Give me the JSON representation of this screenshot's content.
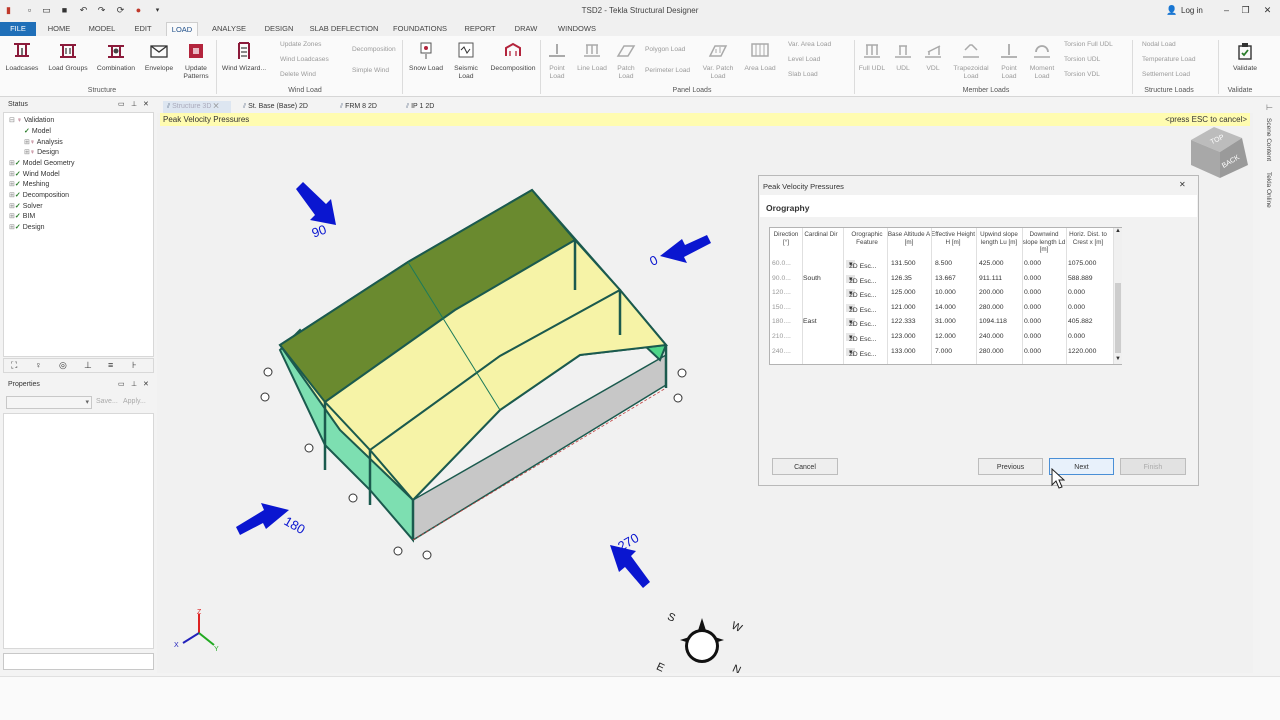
{
  "window": {
    "title": "TSD2 - Tekla Structural Designer",
    "login_label": "Log in"
  },
  "menu": {
    "tabs": [
      "FILE",
      "HOME",
      "MODEL",
      "EDIT",
      "LOAD",
      "ANALYSE",
      "DESIGN",
      "SLAB DEFLECTION",
      "FOUNDATIONS",
      "REPORT",
      "DRAW",
      "WINDOWS"
    ],
    "active": "LOAD"
  },
  "ribbon": {
    "structure": {
      "label": "Structure",
      "loadcases": "Loadcases",
      "load_groups": "Load Groups",
      "combination": "Combination",
      "envelope": "Envelope",
      "update_patterns": "Update Patterns"
    },
    "wind": {
      "label": "Wind Load",
      "wind_wizard": "Wind Wizard...",
      "update_zones": "Update Zones",
      "wind_loadcases": "Wind Loadcases",
      "delete_wind": "Delete Wind",
      "decomposition": "Decomposition",
      "simple_wind": "Simple Wind"
    },
    "snow_load": "Snow Load",
    "seismic_load": "Seismic Load",
    "decomposition": "Decomposition",
    "panel": {
      "label": "Panel Loads",
      "point_load": "Point Load",
      "line_load": "Line Load",
      "patch_load": "Patch Load",
      "polygon_load": "Polygon Load",
      "perimeter_load": "Perimeter Load",
      "var_patch_load": "Var. Patch Load",
      "area_load": "Area Load",
      "var_area_load": "Var. Area Load",
      "level_load": "Level Load",
      "slab_load": "Slab Load"
    },
    "member": {
      "label": "Member Loads",
      "full_udl": "Full UDL",
      "udl": "UDL",
      "vdl": "VDL",
      "trapezoidal_load": "Trapezoidal Load",
      "point_load": "Point Load",
      "moment_load": "Moment Load",
      "torsion_full_udl": "Torsion Full UDL",
      "torsion_udl": "Torsion UDL",
      "torsion_vdl": "Torsion VDL"
    },
    "structure_loads": {
      "label": "Structure Loads",
      "nodal_load": "Nodal Load",
      "temperature_load": "Temperature Load",
      "settlement_load": "Settlement Load"
    },
    "validate": {
      "label": "Validate",
      "button": "Validate"
    }
  },
  "status_panel": {
    "title": "Status",
    "items": [
      "Validation",
      "Model",
      "Analysis",
      "Design",
      "Model Geometry",
      "Wind Model",
      "Meshing",
      "Decomposition",
      "Solver",
      "BIM",
      "Design"
    ]
  },
  "properties_panel": {
    "title": "Properties",
    "save": "Save...",
    "apply": "Apply..."
  },
  "doc_tabs": [
    "Structure 3D",
    "St. Base (Base) 2D",
    "FRM 8 2D",
    "IP 1 2D"
  ],
  "side_tabs": [
    "Scene Content",
    "Tekla Online"
  ],
  "viewport": {
    "prompt_left": "Peak Velocity Pressures",
    "prompt_right": "<press ESC to cancel>",
    "wind_labels": [
      "90",
      "0",
      "180",
      "270"
    ],
    "cube_faces": [
      "TOP",
      "BACK"
    ]
  },
  "dialog": {
    "title": "Peak Velocity Pressures",
    "heading": "Orography",
    "columns": [
      "Direction [°]",
      "Cardinal Dir",
      "Orographic Feature",
      "Base Altitude A [m]",
      "Effective Height H [m]",
      "Upwind slope length Lu [m]",
      "Downwind slope length Ld [m]",
      "Horiz. Dist. to Crest x [m]"
    ],
    "rows": [
      [
        "60.0...",
        "",
        "2D Esc...",
        "131.500",
        "8.500",
        "425.000",
        "0.000",
        "1075.000"
      ],
      [
        "90.0...",
        "South",
        "2D Esc...",
        "126.35",
        "13.667",
        "911.111",
        "0.000",
        "588.889"
      ],
      [
        "120....",
        "",
        "2D Esc...",
        "125.000",
        "10.000",
        "200.000",
        "0.000",
        "0.000"
      ],
      [
        "150....",
        "",
        "2D Esc...",
        "121.000",
        "14.000",
        "280.000",
        "0.000",
        "0.000"
      ],
      [
        "180....",
        "East",
        "2D Esc...",
        "122.333",
        "31.000",
        "1094.118",
        "0.000",
        "405.882"
      ],
      [
        "210....",
        "",
        "2D Esc...",
        "123.000",
        "12.000",
        "240.000",
        "0.000",
        "0.000"
      ],
      [
        "240....",
        "",
        "2D Esc...",
        "133.000",
        "7.000",
        "280.000",
        "0.000",
        "1220.000"
      ]
    ],
    "cancel": "Cancel",
    "previous": "Previous",
    "next": "Next",
    "finish": "Finish"
  },
  "axes": {
    "x": "X",
    "y": "Y",
    "z": "Z"
  },
  "compass": {
    "n": "N",
    "s": "S",
    "e": "E",
    "w": "W"
  },
  "colors": {
    "accent": "#1f6fb8",
    "prompt_bar": "#fffcb0",
    "arrow": "#0a16d0",
    "wall": "#4fd689",
    "roof": "#f6f3a7"
  }
}
